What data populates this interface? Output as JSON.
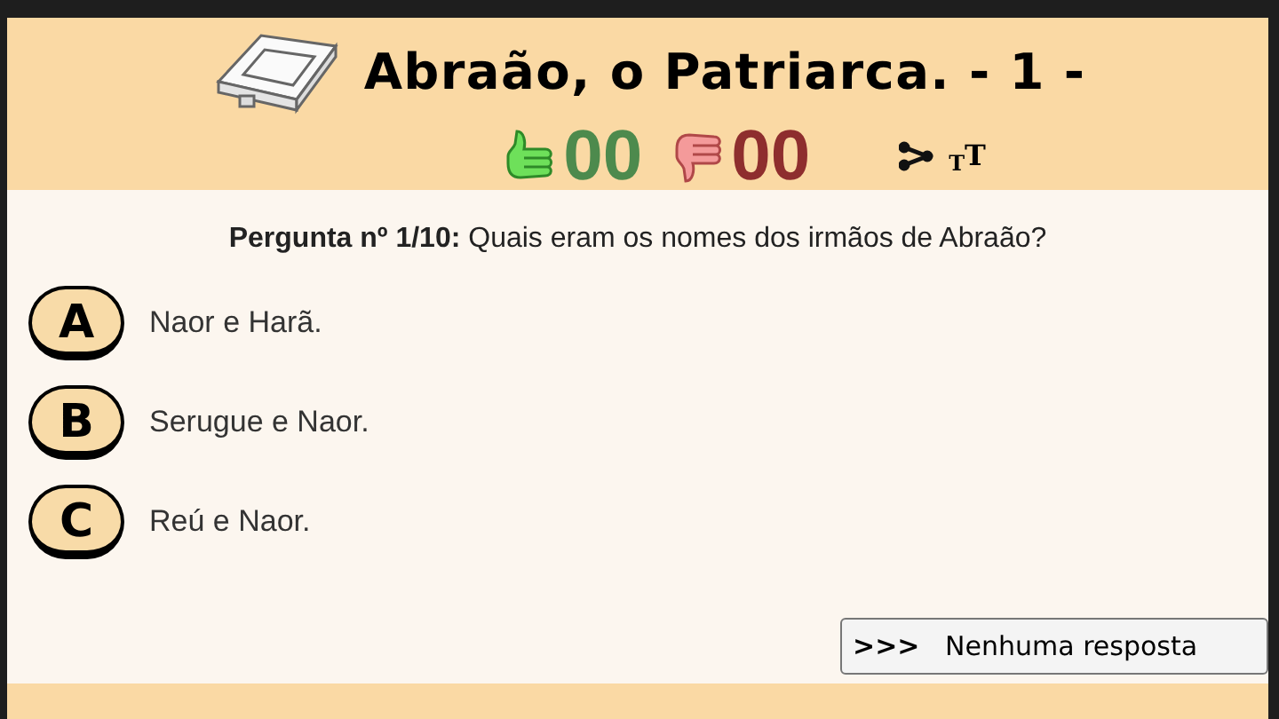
{
  "header": {
    "title": "Abraão, o Patriarca. - 1 -",
    "correct_count": "00",
    "wrong_count": "00",
    "font_size_button": "$_{T}$T"
  },
  "question": {
    "text": "**Pergunta nº 1/10:** Quais eram os nomes dos irmãos de Abraão?"
  },
  "options": [
    {
      "letter": "A",
      "text": "Naor e Harã."
    },
    {
      "letter": "B",
      "text": "Serugue e Naor."
    },
    {
      "letter": "C",
      "text": "Reú e Naor."
    }
  ],
  "skip_button": {
    "label": "**>>>**   Nenhuma resposta"
  }
}
